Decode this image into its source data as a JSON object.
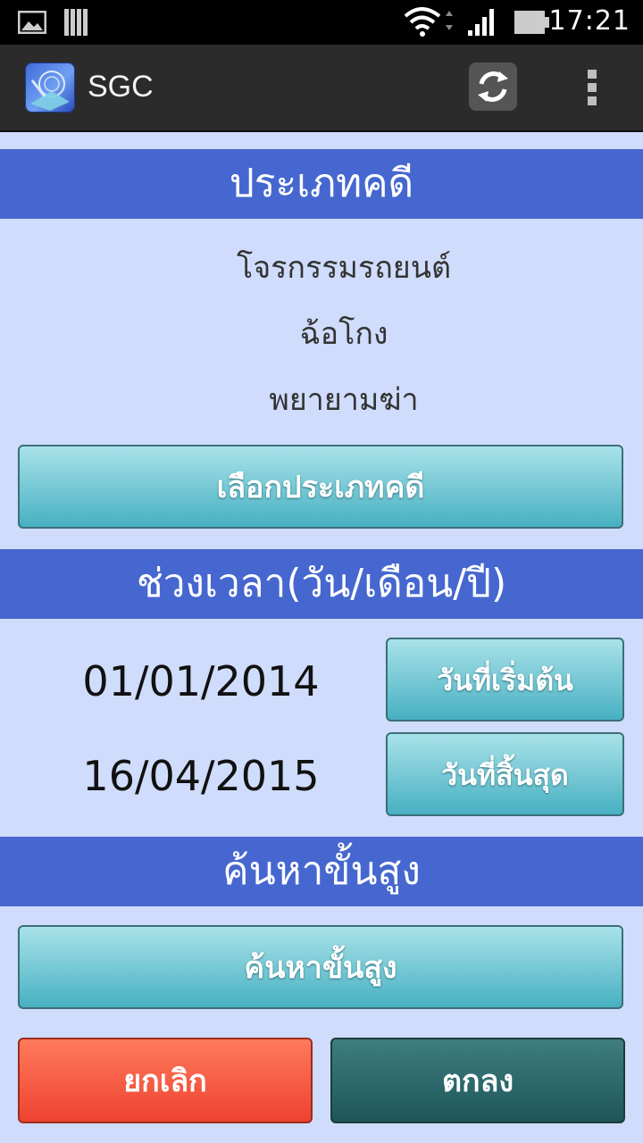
{
  "status_bar": {
    "time": "17:21",
    "icons": [
      "image-notification-icon",
      "storage-notification-icon",
      "wifi-icon",
      "signal-icon",
      "battery-icon"
    ]
  },
  "action_bar": {
    "title": "SGC",
    "icons": [
      "app-logo-icon",
      "refresh-icon",
      "overflow-menu-icon"
    ]
  },
  "case_type": {
    "header": "ประเภทคดี",
    "selected_items": [
      "โจรกรรมรถยนต์",
      "ฉ้อโกง",
      "พยายามฆ่า"
    ],
    "select_button": "เลือกประเภทคดี"
  },
  "period": {
    "header": "ช่วงเวลา(วัน/เดือน/ปี)",
    "start_date": "01/01/2014",
    "start_button": "วันที่เริ่มต้น",
    "end_date": "16/04/2015",
    "end_button": "วันที่สิ้นสุด"
  },
  "advanced": {
    "header": "ค้นหาขั้นสูง",
    "button": "ค้นหาขั้นสูง"
  },
  "actions": {
    "cancel": "ยกเลิก",
    "ok": "ตกลง"
  },
  "colors": {
    "section_header": "#4667cf",
    "background": "#cfdcfb",
    "teal_button": "#47b0c2",
    "cancel_button": "#ee4330",
    "ok_button": "#1d5658"
  }
}
